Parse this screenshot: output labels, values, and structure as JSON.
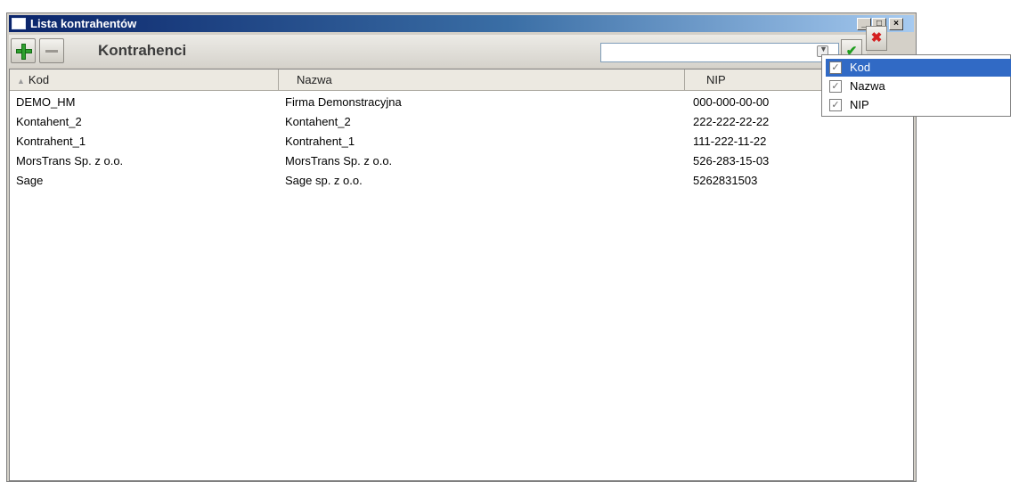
{
  "window": {
    "title": "Lista kontrahentów",
    "controls": {
      "minimize": "_",
      "maximize": "□",
      "close": "×"
    }
  },
  "toolbar": {
    "title": "Kontrahenci",
    "search_value": "",
    "icons": {
      "add": "plus-icon",
      "remove": "minus-icon",
      "accept": "check-icon",
      "cancel": "x-icon",
      "dropdown": "chevron-down-icon"
    },
    "accept_glyph": "✔",
    "cancel_glyph": "✖",
    "dropdown_glyph": "▼"
  },
  "table": {
    "sort_glyph": "▲",
    "columns": [
      "Kod",
      "Nazwa",
      "NIP"
    ],
    "rows": [
      [
        "DEMO_HM",
        "Firma Demonstracyjna",
        "000-000-00-00"
      ],
      [
        "Kontahent_2",
        "Kontahent_2",
        "222-222-22-22"
      ],
      [
        "Kontrahent_1",
        "Kontrahent_1",
        "111-222-11-22"
      ],
      [
        "MorsTrans Sp. z o.o.",
        "MorsTrans Sp. z o.o.",
        "526-283-15-03"
      ],
      [
        "Sage",
        "Sage sp. z o.o.",
        "5262831503"
      ]
    ]
  },
  "column_menu": {
    "items": [
      {
        "label": "Kod",
        "checked": true,
        "selected": true
      },
      {
        "label": "Nazwa",
        "checked": true,
        "selected": false
      },
      {
        "label": "NIP",
        "checked": true,
        "selected": false
      }
    ],
    "check_glyph": "✓"
  },
  "colors": {
    "titlebar_start": "#0a246a",
    "selection": "#316ac5",
    "accept": "#1e9e1e",
    "cancel": "#d42020",
    "add": "#2fa02f"
  }
}
